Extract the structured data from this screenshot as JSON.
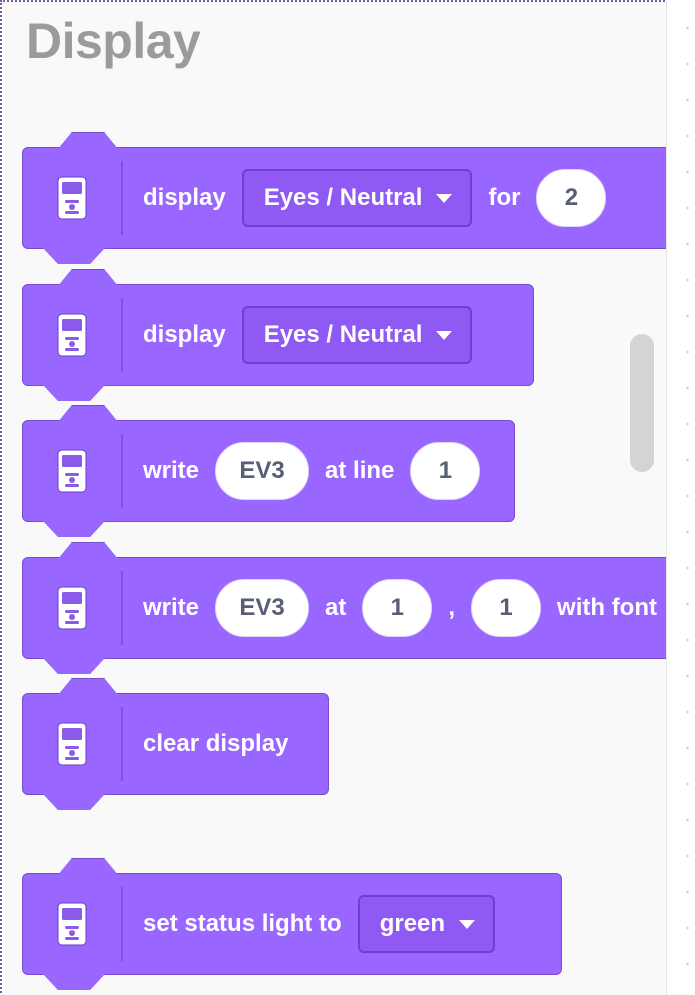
{
  "category": {
    "title": "Display"
  },
  "blocks": [
    {
      "name": "display-for",
      "parts": [
        {
          "kind": "label",
          "text": "display"
        },
        {
          "kind": "dropdown",
          "text": "Eyes / Neutral"
        },
        {
          "kind": "label",
          "text": "for"
        },
        {
          "kind": "number",
          "text": "2"
        }
      ]
    },
    {
      "name": "display",
      "parts": [
        {
          "kind": "label",
          "text": "display"
        },
        {
          "kind": "dropdown",
          "text": "Eyes / Neutral"
        }
      ]
    },
    {
      "name": "write-at-line",
      "parts": [
        {
          "kind": "label",
          "text": "write"
        },
        {
          "kind": "text",
          "text": "EV3"
        },
        {
          "kind": "label",
          "text": "at line"
        },
        {
          "kind": "number",
          "text": "1"
        }
      ]
    },
    {
      "name": "write-at-xy",
      "parts": [
        {
          "kind": "label",
          "text": "write"
        },
        {
          "kind": "text",
          "text": "EV3"
        },
        {
          "kind": "label",
          "text": "at"
        },
        {
          "kind": "number",
          "text": "1"
        },
        {
          "kind": "label",
          "text": ","
        },
        {
          "kind": "number",
          "text": "1"
        },
        {
          "kind": "label",
          "text": "with font"
        }
      ]
    },
    {
      "name": "clear-display",
      "parts": [
        {
          "kind": "label",
          "text": "clear display"
        }
      ]
    },
    {
      "name": "set-status-light",
      "parts": [
        {
          "kind": "label",
          "text": "set status light to"
        },
        {
          "kind": "dropdown",
          "text": "green"
        }
      ]
    }
  ],
  "icon": "ev3-brick-icon",
  "colors": {
    "block": "#9966ff",
    "block_border": "#774dcb",
    "dropdown": "#8f59f4",
    "heading": "#9b9b9b"
  }
}
